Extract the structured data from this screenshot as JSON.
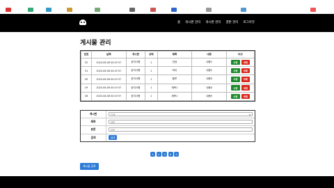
{
  "nav": {
    "items": [
      "홈",
      "게시판 관리",
      "게시판 관리",
      "결판 관리",
      "로그아웃"
    ]
  },
  "page": {
    "title": "게시물 관리"
  },
  "table": {
    "columns": [
      "번호",
      "날짜",
      "게시판",
      "상태",
      "제목",
      "내용",
      "비고"
    ],
    "rows": [
      {
        "no": "32",
        "date": "2020-08-06 00:47:57",
        "board": "공지사항",
        "state": "1",
        "subject": "안녕",
        "content": "내용1",
        "edit": "수정",
        "del": "삭제"
      },
      {
        "no": "31",
        "date": "2020-08-06 00:47:57",
        "board": "공지사항",
        "state": "1",
        "subject": "하이",
        "content": "내용2",
        "edit": "수정",
        "del": "삭제"
      },
      {
        "no": "30",
        "date": "2020-08-06 00:47:57",
        "board": "공지사항",
        "state": "1",
        "subject": "할루",
        "content": "내용3",
        "edit": "수정",
        "del": "삭제"
      },
      {
        "no": "29",
        "date": "2020-08-06 00:47:57",
        "board": "공지사항",
        "state": "1",
        "subject": "제목1",
        "content": "내용4",
        "edit": "수정",
        "del": "삭제"
      },
      {
        "no": "28",
        "date": "2020-08-06 00:47:57",
        "board": "공지사항",
        "state": "1",
        "subject": "제목1",
        "content": "내용5",
        "edit": "수정",
        "del": "삭제"
      }
    ]
  },
  "form": {
    "board_label": "게시판",
    "board_value": "전체",
    "subject_label": "제목",
    "subject_placeholder": "제목",
    "content_label": "본문",
    "content_placeholder": "본문",
    "search_label": "검색",
    "search_button": "검색"
  },
  "pager": {
    "pages": [
      "1",
      "2",
      "3",
      "4",
      "5"
    ]
  },
  "write_button": "게시물 등록",
  "colors": {
    "green": "#1a8a2a",
    "red": "#d9281c",
    "blue": "#2e7bd6",
    "navbar": "#000000"
  },
  "icons": {
    "logo": "robot-icon",
    "select": "chevron-down-icon"
  }
}
